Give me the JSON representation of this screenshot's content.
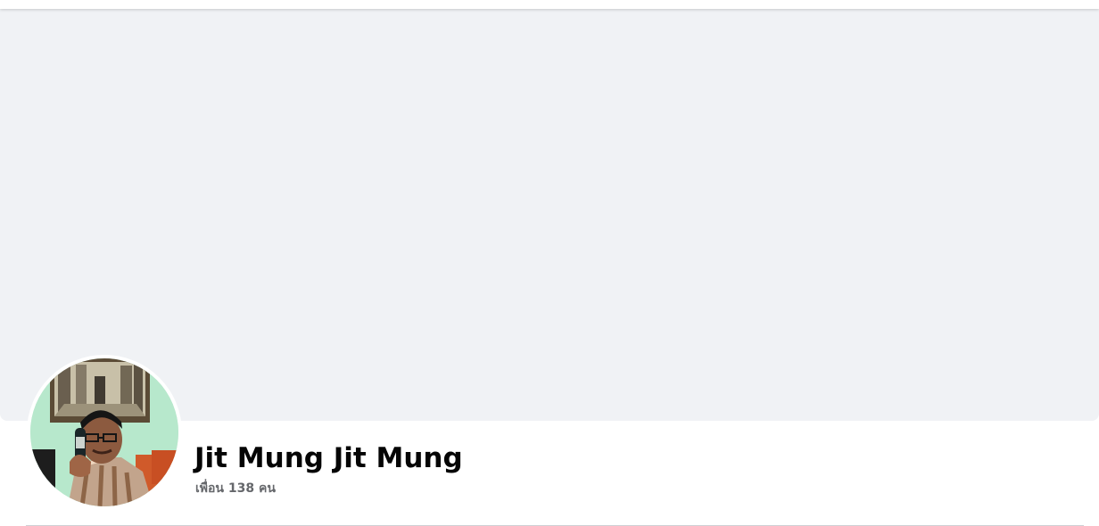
{
  "profile": {
    "name": "Jit Mung Jit Mung",
    "friends_text": "เพื่อน 138 คน",
    "avatar_alt": "Jit Mung Jit Mung"
  },
  "colors": {
    "cover_bg": "#f0f2f5",
    "name_text": "#050505",
    "secondary_text": "#65676b",
    "divider": "#ced0d4"
  }
}
